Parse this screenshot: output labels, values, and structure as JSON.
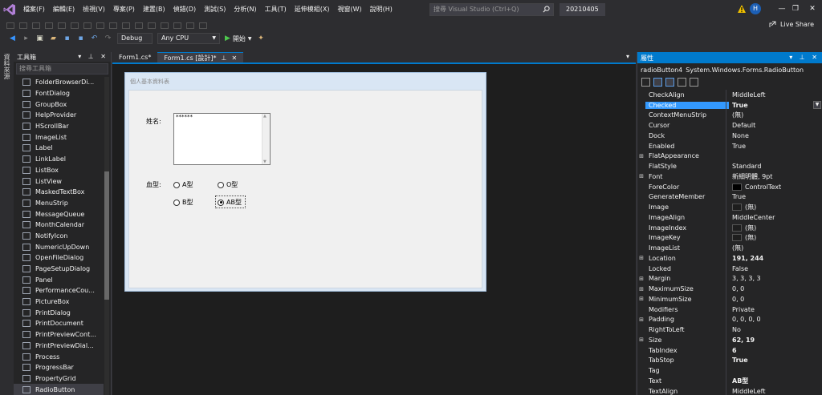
{
  "menubar": {
    "items": [
      "檔案(F)",
      "編輯(E)",
      "檢視(V)",
      "專案(P)",
      "建置(B)",
      "偵錯(D)",
      "測試(S)",
      "分析(N)",
      "工具(T)",
      "延伸模組(X)",
      "視窗(W)",
      "說明(H)"
    ],
    "search_placeholder": "搜尋 Visual Studio (Ctrl+Q)",
    "solution_name": "20210405",
    "avatar_initial": "H",
    "window_controls": [
      "—",
      "❐",
      "✕"
    ]
  },
  "toolbar": {
    "config": "Debug",
    "platform": "Any CPU",
    "start_label": "開始",
    "live_share": "Live Share"
  },
  "side_strip": {
    "label": "資料來源"
  },
  "toolbox": {
    "title": "工具箱",
    "search_placeholder": "搜尋工具箱",
    "items": [
      "FolderBrowserDi...",
      "FontDialog",
      "GroupBox",
      "HelpProvider",
      "HScrollBar",
      "ImageList",
      "Label",
      "LinkLabel",
      "ListBox",
      "ListView",
      "MaskedTextBox",
      "MenuStrip",
      "MessageQueue",
      "MonthCalendar",
      "NotifyIcon",
      "NumericUpDown",
      "OpenFileDialog",
      "PageSetupDialog",
      "Panel",
      "PerformanceCou...",
      "PictureBox",
      "PrintDialog",
      "PrintDocument",
      "PrintPreviewCont...",
      "PrintPreviewDial...",
      "Process",
      "ProgressBar",
      "PropertyGrid",
      "RadioButton"
    ],
    "icons": [
      "(.)",
      "A",
      "A"
    ]
  },
  "doc_tabs": [
    {
      "label": "Form1.cs*"
    },
    {
      "label": "Form1.cs [設計]*"
    }
  ],
  "form": {
    "title": "個人基本資料表",
    "name_label": "姓名:",
    "name_value": "******",
    "blood_label": "血型:",
    "radios": [
      {
        "label": "A型",
        "checked": false
      },
      {
        "label": "O型",
        "checked": false
      },
      {
        "label": "B型",
        "checked": false
      },
      {
        "label": "AB型",
        "checked": true
      }
    ]
  },
  "properties": {
    "title": "屬性",
    "object_name": "radioButton4",
    "object_type": "System.Windows.Forms.RadioButton",
    "rows": [
      {
        "name": "CheckAlign",
        "value": "MiddleLeft",
        "expand": "",
        "selected": false,
        "bold": false
      },
      {
        "name": "Checked",
        "value": "True",
        "expand": "",
        "selected": true,
        "bold": true
      },
      {
        "name": "ContextMenuStrip",
        "value": "(無)",
        "expand": "",
        "selected": false,
        "bold": false
      },
      {
        "name": "Cursor",
        "value": "Default",
        "expand": "",
        "selected": false,
        "bold": false
      },
      {
        "name": "Dock",
        "value": "None",
        "expand": "",
        "selected": false,
        "bold": false
      },
      {
        "name": "Enabled",
        "value": "True",
        "expand": "",
        "selected": false,
        "bold": false
      },
      {
        "name": "FlatAppearance",
        "value": "",
        "expand": "⊞",
        "selected": false,
        "bold": false
      },
      {
        "name": "FlatStyle",
        "value": "Standard",
        "expand": "",
        "selected": false,
        "bold": false
      },
      {
        "name": "Font",
        "value": "新細明體, 9pt",
        "expand": "⊞",
        "selected": false,
        "bold": false
      },
      {
        "name": "ForeColor",
        "value": "ControlText",
        "expand": "",
        "selected": false,
        "bold": false,
        "swatch": "#000000"
      },
      {
        "name": "GenerateMember",
        "value": "True",
        "expand": "",
        "selected": false,
        "bold": false
      },
      {
        "name": "Image",
        "value": "(無)",
        "expand": "",
        "selected": false,
        "bold": false,
        "swatch": "#1e1e1e"
      },
      {
        "name": "ImageAlign",
        "value": "MiddleCenter",
        "expand": "",
        "selected": false,
        "bold": false
      },
      {
        "name": "ImageIndex",
        "value": "(無)",
        "expand": "",
        "selected": false,
        "bold": false,
        "swatch": "#1e1e1e"
      },
      {
        "name": "ImageKey",
        "value": "(無)",
        "expand": "",
        "selected": false,
        "bold": false,
        "swatch": "#1e1e1e"
      },
      {
        "name": "ImageList",
        "value": "(無)",
        "expand": "",
        "selected": false,
        "bold": false
      },
      {
        "name": "Location",
        "value": "191, 244",
        "expand": "⊞",
        "selected": false,
        "bold": true
      },
      {
        "name": "Locked",
        "value": "False",
        "expand": "",
        "selected": false,
        "bold": false
      },
      {
        "name": "Margin",
        "value": "3, 3, 3, 3",
        "expand": "⊞",
        "selected": false,
        "bold": false
      },
      {
        "name": "MaximumSize",
        "value": "0, 0",
        "expand": "⊞",
        "selected": false,
        "bold": false
      },
      {
        "name": "MinimumSize",
        "value": "0, 0",
        "expand": "⊞",
        "selected": false,
        "bold": false
      },
      {
        "name": "Modifiers",
        "value": "Private",
        "expand": "",
        "selected": false,
        "bold": false
      },
      {
        "name": "Padding",
        "value": "0, 0, 0, 0",
        "expand": "⊞",
        "selected": false,
        "bold": false
      },
      {
        "name": "RightToLeft",
        "value": "No",
        "expand": "",
        "selected": false,
        "bold": false
      },
      {
        "name": "Size",
        "value": "62, 19",
        "expand": "⊞",
        "selected": false,
        "bold": true
      },
      {
        "name": "TabIndex",
        "value": "6",
        "expand": "",
        "selected": false,
        "bold": true
      },
      {
        "name": "TabStop",
        "value": "True",
        "expand": "",
        "selected": false,
        "bold": true
      },
      {
        "name": "Tag",
        "value": "",
        "expand": "",
        "selected": false,
        "bold": false
      },
      {
        "name": "Text",
        "value": "AB型",
        "expand": "",
        "selected": false,
        "bold": true
      },
      {
        "name": "TextAlign",
        "value": "MiddleLeft",
        "expand": "",
        "selected": false,
        "bold": false
      }
    ]
  },
  "colors": {
    "accent": "#007acc",
    "selection": "#3399ff",
    "background": "#2d2d30",
    "panel": "#252526",
    "warning": "#f0c000"
  }
}
